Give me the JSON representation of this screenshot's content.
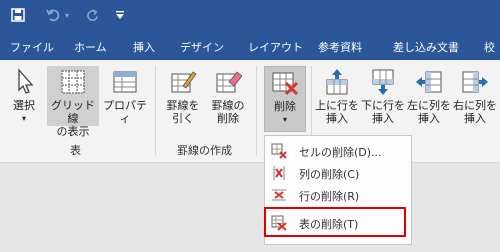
{
  "quick_access": {
    "save_icon": "save-icon",
    "undo_icon": "undo-icon",
    "redo_icon": "redo-icon",
    "customize_icon": "customize-qat-icon"
  },
  "tabs": [
    "ファイル",
    "ホーム",
    "挿入",
    "デザイン",
    "レイアウト",
    "参考資料",
    "差し込み文書",
    "校"
  ],
  "ribbon": {
    "select": {
      "line1": "選択",
      "line2": "▾"
    },
    "gridlines": {
      "line1": "グリッド線",
      "line2": "の表示"
    },
    "properties": {
      "line1": "プロパティ"
    },
    "group_table": "表",
    "draw_line": {
      "line1": "罫線を",
      "line2": "引く"
    },
    "erase_line": {
      "line1": "罫線の",
      "line2": "削除"
    },
    "group_draw": "罫線の作成",
    "delete": {
      "line1": "削除",
      "line2": "▾"
    },
    "insert_above": {
      "line1": "上に行を",
      "line2": "挿入"
    },
    "insert_below": {
      "line1": "下に行を",
      "line2": "挿入"
    },
    "insert_left": {
      "line1": "左に列を",
      "line2": "挿入"
    },
    "insert_right": {
      "line1": "右に列を",
      "line2": "挿入"
    }
  },
  "delete_menu": {
    "items": [
      {
        "label": "セルの削除(D)..."
      },
      {
        "label": "列の削除(C)"
      },
      {
        "label": "行の削除(R)"
      },
      {
        "label": "表の削除(T)"
      }
    ]
  },
  "colors": {
    "title_bar": "#2b579a",
    "highlight": "#e00000",
    "delete_red": "#d6342c"
  }
}
